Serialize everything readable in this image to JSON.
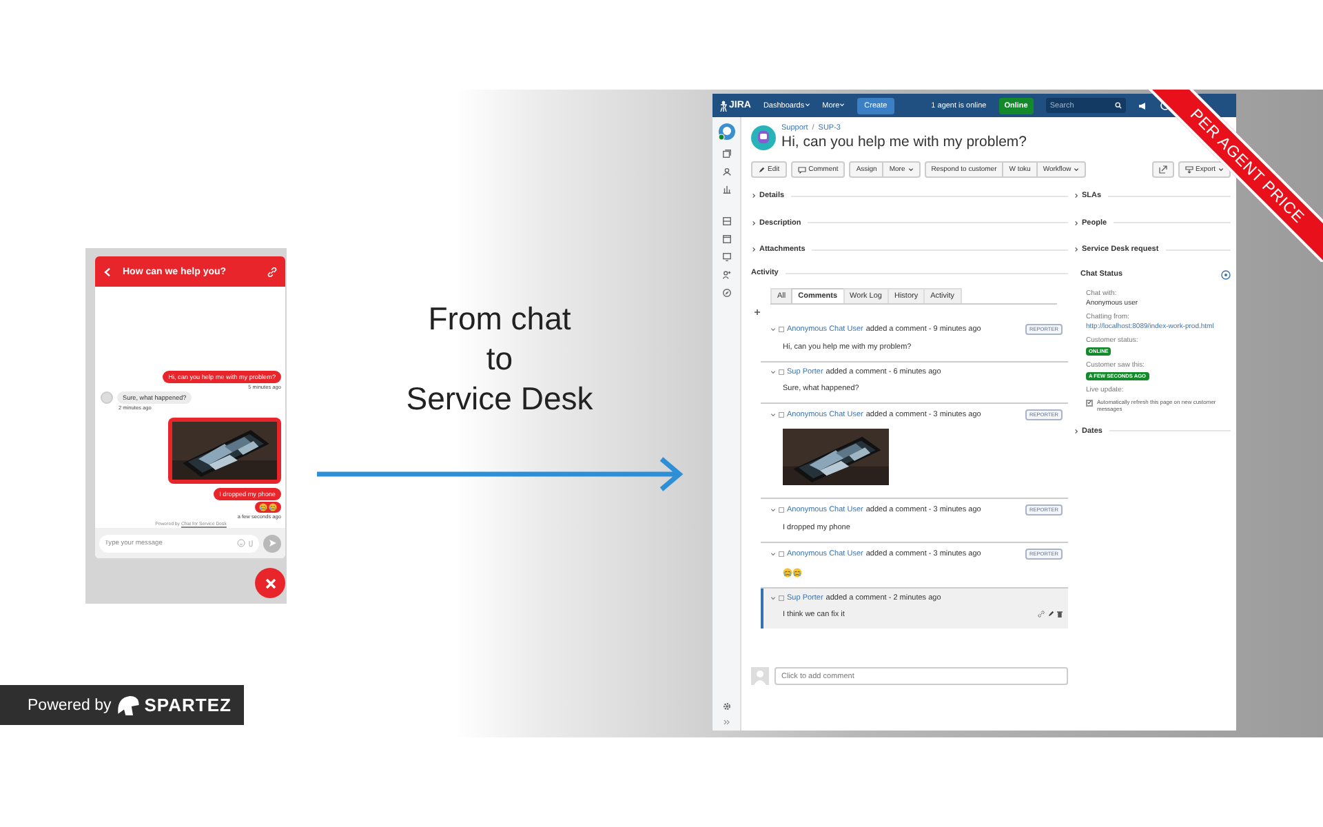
{
  "chat_widget": {
    "title": "How can we help you?",
    "messages": [
      {
        "kind": "customer_text",
        "text": "Hi, can you help me with my problem?",
        "time": "5 minutes ago"
      },
      {
        "kind": "agent_text",
        "text": "Sure, what happened?",
        "time": "2 minutes ago"
      },
      {
        "kind": "customer_picture"
      },
      {
        "kind": "customer_text",
        "text": "I dropped my phone"
      },
      {
        "kind": "customer_emoji",
        "time": "a few seconds ago"
      }
    ],
    "powered_by": {
      "text": "Powered by",
      "link": "Chat for Service Desk"
    },
    "input": {
      "placeholder": "Type your message"
    }
  },
  "headline": [
    "From chat",
    "to",
    "Service Desk"
  ],
  "ribbon": "PER AGENT PRICE",
  "powered_badge": {
    "text": "Powered by",
    "brand": "SPARTEZ"
  },
  "jira": {
    "nav": {
      "logo": "JIRA",
      "menus": [
        {
          "label": "Dashboards",
          "dropdown": true
        },
        {
          "label": "More",
          "dropdown": true
        }
      ],
      "create": "Create",
      "agents": "1 agent is online",
      "status": "Online",
      "search_placeholder": "Search"
    },
    "issue": {
      "breadcrumb": {
        "items": [
          "Support",
          "SUP-3"
        ],
        "separator": "/"
      },
      "title": "Hi, can you help me with my problem?"
    },
    "toolbar": [
      [
        {
          "label": "Edit",
          "dropdown": false
        }
      ],
      [
        {
          "label": "Comment",
          "dropdown": false
        }
      ],
      [
        {
          "label": "Assign",
          "dropdown": false
        },
        {
          "label": "More",
          "dropdown": true
        }
      ],
      [
        {
          "label": "Respond to customer",
          "dropdown": false
        },
        {
          "label": "W toku",
          "dropdown": false
        },
        {
          "label": "Workflow",
          "dropdown": true
        }
      ]
    ],
    "toolbar_right": [
      [
        {
          "dropdown": false
        }
      ],
      [
        {
          "label": "Export",
          "dropdown": true
        }
      ]
    ],
    "sections": [
      "Details",
      "Description",
      "Attachments"
    ],
    "activity": {
      "heading": "Activity",
      "tabs": [
        {
          "label": "All",
          "selected": false
        },
        {
          "label": "Comments",
          "selected": true
        },
        {
          "label": "Work Log",
          "selected": false
        },
        {
          "label": "History",
          "selected": false
        },
        {
          "label": "Activity",
          "selected": false
        }
      ],
      "comments": [
        {
          "author": "Anonymous Chat User",
          "meta": "added a comment - 9 minutes ago",
          "role": "REPORTER",
          "kind": "text",
          "body": "Hi, can you help me with my problem?",
          "highlighted": false
        },
        {
          "author": "Sup Porter",
          "meta": "added a comment - 6 minutes ago",
          "kind": "text",
          "body": "Sure, what happened?",
          "highlighted": false
        },
        {
          "author": "Anonymous Chat User",
          "meta": "added a comment - 3 minutes ago",
          "role": "REPORTER",
          "kind": "picture",
          "highlighted": false
        },
        {
          "author": "Anonymous Chat User",
          "meta": "added a comment - 3 minutes ago",
          "role": "REPORTER",
          "kind": "text",
          "body": "I dropped my phone",
          "highlighted": false
        },
        {
          "author": "Anonymous Chat User",
          "meta": "added a comment - 3 minutes ago",
          "role": "REPORTER",
          "kind": "emoji",
          "highlighted": false
        },
        {
          "author": "Sup Porter",
          "meta": "added a comment - 2 minutes ago",
          "kind": "text",
          "body": "I think we can fix it",
          "highlighted": true
        }
      ]
    },
    "add_comment": {
      "placeholder": "Click to add comment"
    },
    "side_sections": [
      "SLAs",
      "People",
      "Service Desk request"
    ],
    "chat_status": {
      "heading": "Chat Status",
      "fields": [
        {
          "label": "Chat with:",
          "kind": "text",
          "value": "Anonymous user"
        },
        {
          "label": "Chatting from:",
          "kind": "link",
          "value": "http://localhost:8089/index-work-prod.html"
        },
        {
          "label": "Customer status:",
          "kind": "badge",
          "value": "ONLINE"
        },
        {
          "label": "Customer saw this:",
          "kind": "badge",
          "value": "A FEW SECONDS AGO"
        },
        {
          "label": "Live update:",
          "kind": "checkbox",
          "checked": true,
          "value": "Automatically refresh this page on new customer messages"
        }
      ]
    },
    "end_sections": [
      "Dates"
    ]
  }
}
